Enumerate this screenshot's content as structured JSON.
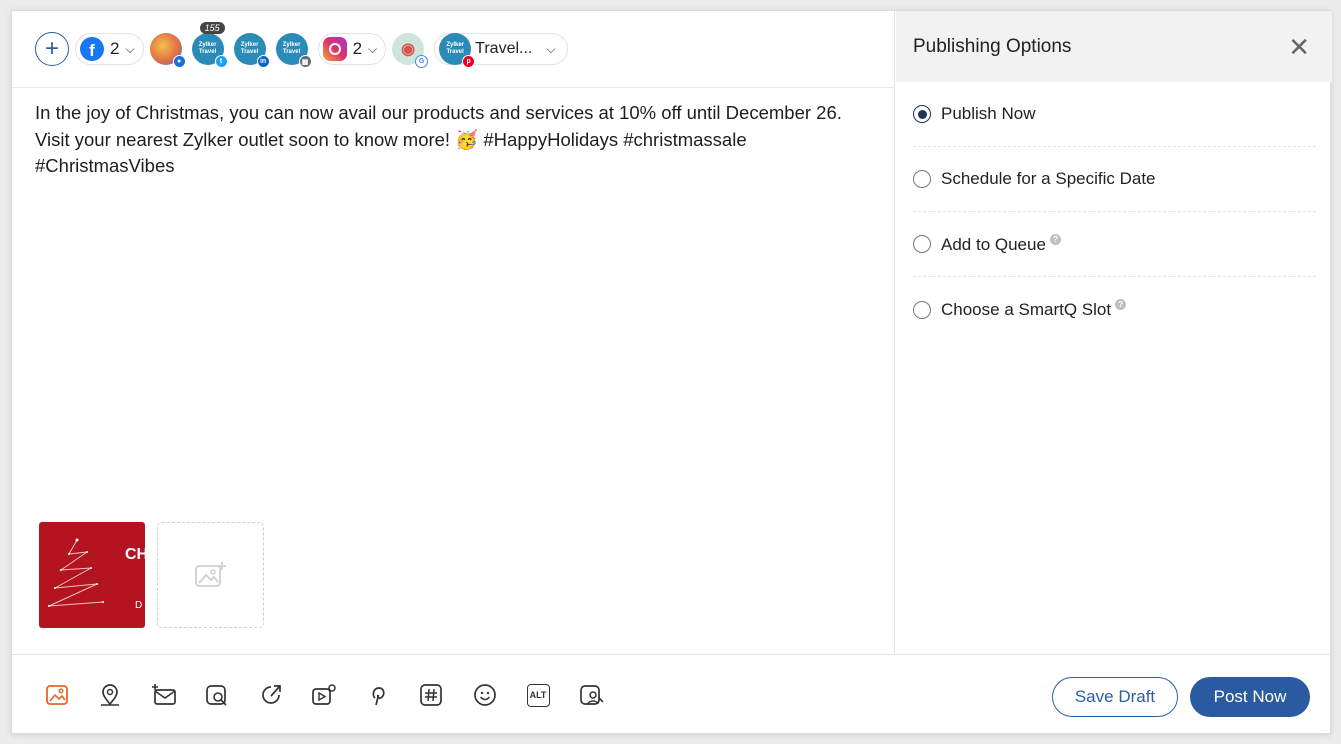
{
  "composer": {
    "add_label": "+",
    "facebook_count": "2",
    "instagram_count": "2",
    "twitter_badge_count": "155",
    "travel_label": "Travel...",
    "avatar_label": "Zylker Travel",
    "post_text": "In the joy of Christmas, you can now avail our products and services at 10% off until December 26. Visit your nearest Zylker outlet soon to know more! 🥳 #HappyHolidays #christmassale #ChristmasVibes",
    "thumbnail_text": "CH",
    "thumbnail_sub": "D"
  },
  "channels": [
    {
      "name": "facebook",
      "icon": "facebook-icon"
    },
    {
      "name": "people-group",
      "icon": "group-avatar"
    },
    {
      "name": "twitter",
      "icon": "twitter-badge-icon"
    },
    {
      "name": "linkedin",
      "icon": "linkedin-badge-icon"
    },
    {
      "name": "google-business",
      "icon": "business-badge-icon"
    },
    {
      "name": "instagram",
      "icon": "instagram-icon"
    },
    {
      "name": "google-maps",
      "icon": "google-badge-icon"
    },
    {
      "name": "pinterest",
      "icon": "pinterest-badge-icon"
    }
  ],
  "toolbar": {
    "tools": [
      "image-icon",
      "location-icon",
      "mail-add-icon",
      "search-image-icon",
      "link-share-icon",
      "video-settings-icon",
      "pinterest-icon",
      "hashtag-icon",
      "emoji-icon",
      "alt-text-icon",
      "user-search-icon"
    ],
    "alt_label": "ALT",
    "save_draft_label": "Save Draft",
    "post_now_label": "Post Now"
  },
  "publishing": {
    "title": "Publishing Options",
    "options": [
      {
        "label": "Publish Now",
        "selected": true,
        "help": false
      },
      {
        "label": "Schedule for a Specific Date",
        "selected": false,
        "help": false
      },
      {
        "label": "Add to Queue",
        "selected": false,
        "help": true
      },
      {
        "label": "Choose a SmartQ Slot",
        "selected": false,
        "help": true
      }
    ],
    "help_glyph": "?"
  },
  "colors": {
    "accent": "#2a5aa0",
    "active_tool": "#e8652a",
    "thumbnail": "#b3141f"
  }
}
